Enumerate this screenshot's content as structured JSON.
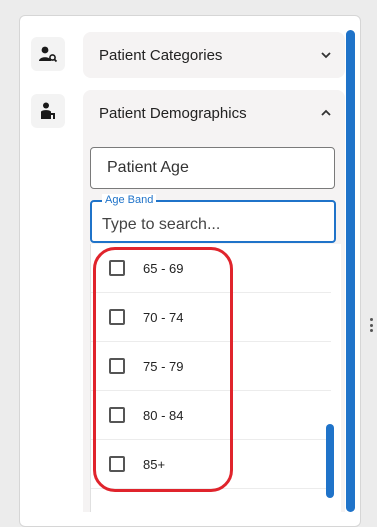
{
  "filters": [
    {
      "label": "Patient Categories",
      "icon": "person-search-icon",
      "expanded": false
    },
    {
      "label": "Patient Demographics",
      "icon": "person-desk-icon",
      "expanded": true
    }
  ],
  "patient_age": {
    "value": "Patient Age"
  },
  "age_band": {
    "label": "Age Band",
    "placeholder": "Type to search...",
    "options": [
      "65 - 69",
      "70 - 74",
      "75 - 79",
      "80 - 84",
      "85+"
    ]
  },
  "colors": {
    "accent": "#1f73c9",
    "highlight": "#e0242c"
  }
}
